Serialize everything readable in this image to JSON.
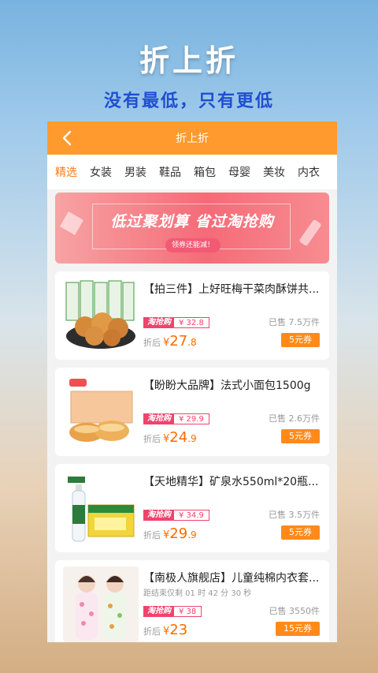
{
  "promo": {
    "title": "折上折",
    "subtitle": "没有最低，只有更低"
  },
  "appbar": {
    "back_icon": "chevron-left-icon",
    "title": "折上折"
  },
  "tabs": [
    "精选",
    "女装",
    "男装",
    "鞋品",
    "箱包",
    "母婴",
    "美妆",
    "内衣"
  ],
  "active_tab": 0,
  "banner": {
    "headline": "低过聚划算 省过淘抢购",
    "sub": "领券还能减！"
  },
  "products": [
    {
      "title": "【拍三件】上好旺梅干菜肉酥饼共...",
      "countdown": "",
      "tag_name": "淘抢购",
      "tag_price": "¥ 32.8",
      "after_label": "折后",
      "after_yen": "¥",
      "after_int": "27",
      "after_dec": ".8",
      "sold": "已售 7.5万件",
      "coupon": "5元券",
      "image": "pastry-image"
    },
    {
      "title": "【盼盼大品牌】法式小面包1500g",
      "countdown": "",
      "tag_name": "淘抢购",
      "tag_price": "¥ 29.9",
      "after_label": "折后",
      "after_yen": "¥",
      "after_int": "24",
      "after_dec": ".9",
      "sold": "已售 2.6万件",
      "coupon": "5元券",
      "image": "bread-image"
    },
    {
      "title": "【天地精华】矿泉水550ml*20瓶...",
      "countdown": "",
      "tag_name": "淘抢购",
      "tag_price": "¥ 34.9",
      "after_label": "折后",
      "after_yen": "¥",
      "after_int": "29",
      "after_dec": ".9",
      "sold": "已售 3.5万件",
      "coupon": "5元券",
      "image": "water-image"
    },
    {
      "title": "【南极人旗舰店】儿童纯棉内衣套...",
      "countdown": "距结束仅剩 01 时 42 分 30 秒",
      "tag_name": "淘抢购",
      "tag_price": "¥ 38",
      "after_label": "折后",
      "after_yen": "¥",
      "after_int": "23",
      "after_dec": "",
      "sold": "已售 3550件",
      "coupon": "15元券",
      "image": "kids-pajamas-image"
    }
  ],
  "colors": {
    "accent": "#ff9a2e",
    "tag": "#f0446d",
    "price": "#ff6a00",
    "subtitle": "#1f4fd1"
  }
}
